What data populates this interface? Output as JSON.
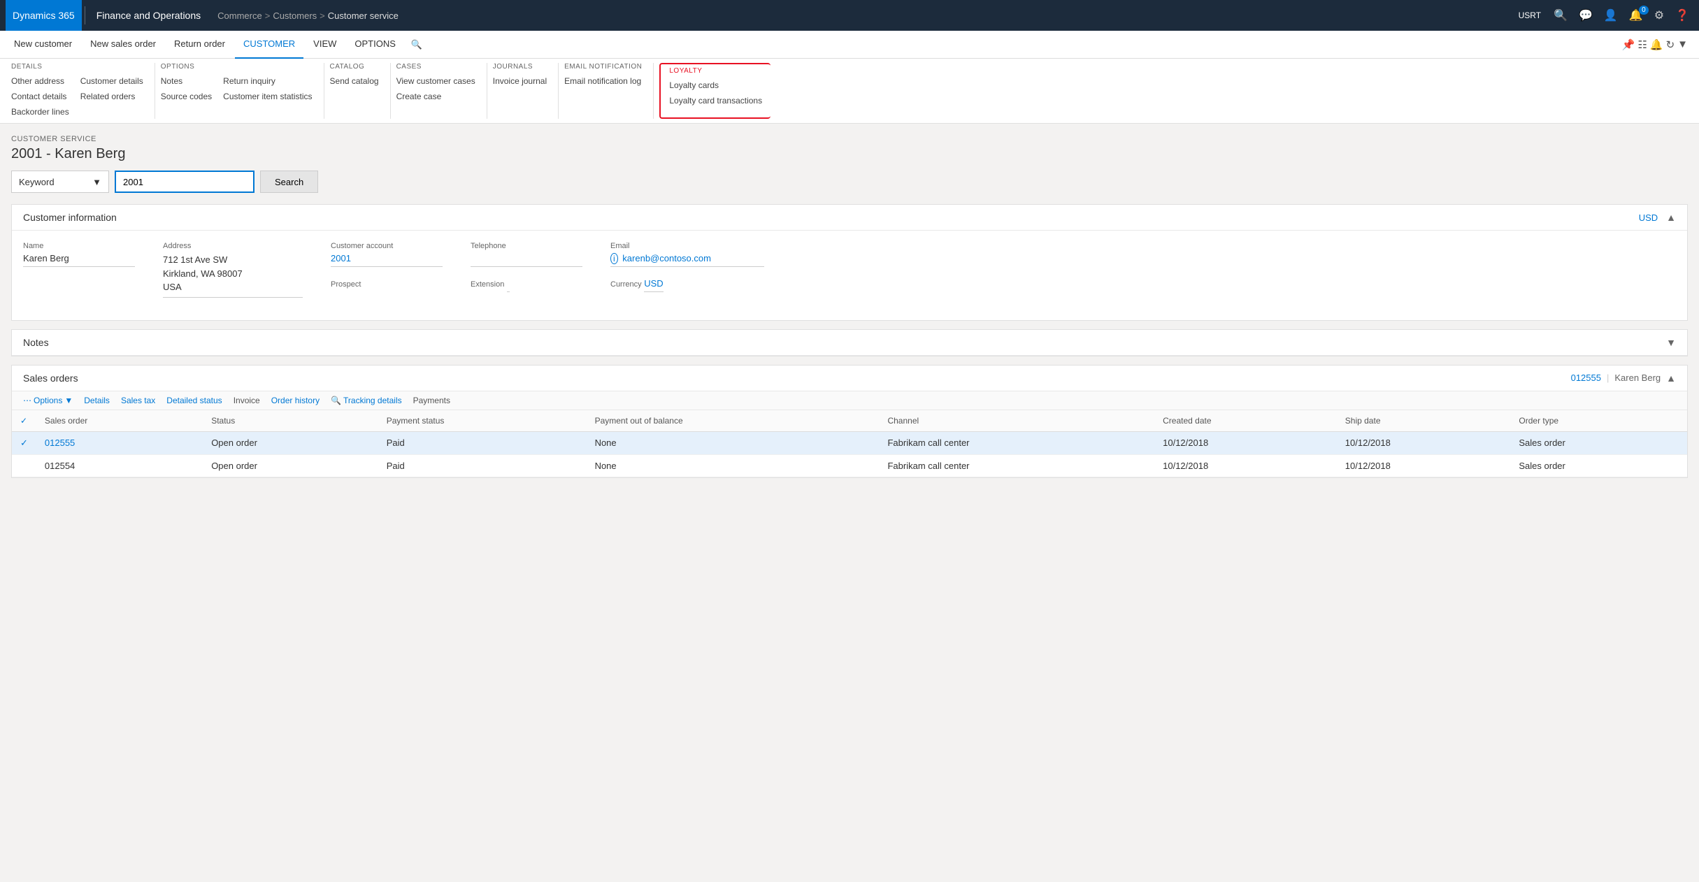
{
  "topNav": {
    "brand": "Dynamics 365",
    "appTitle": "Finance and Operations",
    "breadcrumbs": [
      "Commerce",
      "Customers",
      "Customer service"
    ],
    "user": "USRT"
  },
  "ribbonTabs": [
    {
      "label": "New customer",
      "active": false
    },
    {
      "label": "New sales order",
      "active": false
    },
    {
      "label": "Return order",
      "active": false
    },
    {
      "label": "CUSTOMER",
      "active": true
    },
    {
      "label": "VIEW",
      "active": false
    },
    {
      "label": "OPTIONS",
      "active": false
    }
  ],
  "ribbonGroups": {
    "details": {
      "title": "DETAILS",
      "items": [
        "Other address",
        "Contact details",
        "Backorder lines",
        "Customer details",
        "Related orders"
      ]
    },
    "options": {
      "title": "OPTIONS",
      "items": [
        "Notes",
        "Return inquiry",
        "Source codes",
        "Customer item statistics"
      ]
    },
    "catalog": {
      "title": "CATALOG",
      "items": [
        "Send catalog"
      ]
    },
    "cases": {
      "title": "CASES",
      "items": [
        "View customer cases",
        "Create case"
      ]
    },
    "journals": {
      "title": "JOURNALS",
      "items": [
        "Invoice journal"
      ]
    },
    "emailNotification": {
      "title": "EMAIL NOTIFICATION",
      "items": [
        "Email notification log"
      ]
    },
    "loyalty": {
      "title": "LOYALTY",
      "items": [
        "Loyalty cards",
        "Loyalty card transactions"
      ]
    }
  },
  "customerService": {
    "sectionLabel": "CUSTOMER SERVICE",
    "title": "2001 - Karen Berg"
  },
  "searchBar": {
    "dropdownLabel": "Keyword",
    "searchValue": "2001",
    "searchPlaceholder": "Search",
    "searchButtonLabel": "Search"
  },
  "customerInfo": {
    "sectionTitle": "Customer information",
    "currencyBadge": "USD",
    "name": {
      "label": "Name",
      "value": "Karen Berg"
    },
    "address": {
      "label": "Address",
      "value": "712 1st Ave SW\nKirkland, WA 98007\nUSA"
    },
    "customerAccount": {
      "label": "Customer account",
      "value": "2001"
    },
    "prospect": {
      "label": "Prospect",
      "value": ""
    },
    "telephone": {
      "label": "Telephone",
      "value": ""
    },
    "extension": {
      "label": "Extension",
      "value": ""
    },
    "email": {
      "label": "Email",
      "value": "karenb@contoso.com"
    },
    "currency": {
      "label": "Currency",
      "value": "USD"
    }
  },
  "notes": {
    "sectionTitle": "Notes",
    "collapsed": true
  },
  "salesOrders": {
    "sectionTitle": "Sales orders",
    "headerLink": "012555",
    "headerName": "Karen Berg",
    "actions": [
      {
        "label": "Options",
        "type": "dropdown"
      },
      {
        "label": "Details"
      },
      {
        "label": "Sales tax"
      },
      {
        "label": "Detailed status"
      },
      {
        "label": "Invoice",
        "gray": true
      },
      {
        "label": "Order history"
      },
      {
        "label": "Tracking details"
      },
      {
        "label": "Payments",
        "gray": true
      }
    ],
    "columns": [
      "Sales order",
      "Status",
      "Payment status",
      "Payment out of balance",
      "Channel",
      "Created date",
      "Ship date",
      "Order type"
    ],
    "rows": [
      {
        "selected": true,
        "salesOrder": "012555",
        "status": "Open order",
        "paymentStatus": "Paid",
        "paymentOutOfBalance": "None",
        "channel": "Fabrikam call center",
        "createdDate": "10/12/2018",
        "shipDate": "10/12/2018",
        "orderType": "Sales order"
      },
      {
        "selected": false,
        "salesOrder": "012554",
        "status": "Open order",
        "paymentStatus": "Paid",
        "paymentOutOfBalance": "None",
        "channel": "Fabrikam call center",
        "createdDate": "10/12/2018",
        "shipDate": "10/12/2018",
        "orderType": "Sales order"
      }
    ]
  }
}
